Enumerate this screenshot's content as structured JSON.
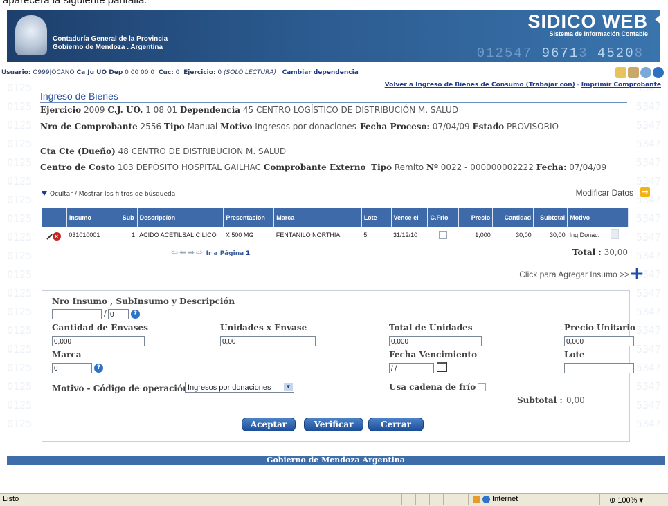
{
  "caption": "aparecerá la siguiente pantalla:",
  "banner": {
    "org_line1": "Contaduría General de la Provincia",
    "org_line2": "Gobierno de Mendoza . Argentina",
    "brand": "SIDICO  WEB",
    "brand_sub": "Sistema de Información Contable",
    "digits_a": "012547 ",
    "digits_b": "9671",
    "digits_c": "3 ",
    "digits_d": "4520",
    "digits_e": "8"
  },
  "userbar": {
    "label_usuario": "Usuario:",
    "usuario": "O999JOCANO",
    "label_caju": "Ca Ju UO Dep",
    "caju": "0 00 00 0",
    "label_cuc": "Cuc:",
    "cuc": "0",
    "label_ejercicio": "Ejercicio:",
    "ejercicio": "0",
    "mode": "(SOLO LECTURA)",
    "change_link": "Cambiar dependencia"
  },
  "links": {
    "back": "Volver a Ingreso de Bienes de Consumo (Trabajar con)",
    "sep": " - ",
    "print": "Imprimir Comprobante"
  },
  "title": "Ingreso de Bienes",
  "info": {
    "l_ejercicio": "Ejercicio",
    "ejercicio": "2009",
    "l_cju": "C.J. UO.",
    "cju": "1 08 01",
    "l_dependencia": "Dependencia",
    "dependencia": "45 CENTRO LOGÍSTICO DE DISTRIBUCIÓN M. SALUD",
    "l_nro": "Nro de Comprobante",
    "nro": "2556",
    "l_tipo": "Tipo",
    "tipo": "Manual",
    "l_motivo": "Motivo",
    "motivo": "Ingresos por donaciones",
    "l_fecha_proceso": "Fecha Proceso:",
    "fecha_proceso": "07/04/09",
    "l_estado": "Estado",
    "estado": "PROVISORIO",
    "l_ctacte": "Cta Cte (Dueño)",
    "ctacte": "48 CENTRO DE DISTRIBUCION M. SALUD",
    "l_centro": "Centro de Costo",
    "centro": "103 DEPÓSITO HOSPITAL GAILHAC",
    "l_comp_ext": "Comprobante Externo",
    "l_tipo2": "Tipo",
    "tipo2": "Remito",
    "l_numero": "Nº",
    "numero": "0022 - 000000002222",
    "l_fecha": "Fecha:",
    "fecha": "07/04/09"
  },
  "filters_toggle": "Ocultar / Mostrar los filtros de búsqueda",
  "modify_label": "Modificar Datos",
  "grid": {
    "headers": [
      "Insumo",
      "Sub",
      "Descripción",
      "Presentación",
      "Marca",
      "Lote",
      "Vence el",
      "C.Frio",
      "Precio",
      "Cantidad",
      "Subtotal",
      "Motivo"
    ],
    "row": {
      "insumo": "031010001",
      "sub": "1",
      "descripcion": "ACIDO ACETILSALICILICO",
      "presentacion": "X 500 MG",
      "marca": "FENTANILO NORTHIA",
      "lote": "5",
      "vence": "31/12/10",
      "precio": "1,000",
      "cantidad": "30,00",
      "subtotal": "30,00",
      "motivo": "Ing.Donac."
    }
  },
  "pager": {
    "label": "Ir a Página",
    "page": "1"
  },
  "total": {
    "label": "Total :",
    "value": "30,00"
  },
  "add_insumo": "Click para Agregar Insumo >>",
  "form": {
    "l_insumo": "Nro Insumo , SubInsumo y Descripción",
    "insumo_value": "",
    "slash": "/",
    "subinsumo_value": "0",
    "l_cant_env": "Cantidad de Envases",
    "cant_env": "0,000",
    "l_unid_env": "Unidades x Envase",
    "unid_env": "0,00",
    "l_total_unid": "Total de Unidades",
    "total_unid": "0,000",
    "l_precio_unit": "Precio Unitario",
    "precio_unit": "0,000",
    "l_marca": "Marca",
    "marca": "0",
    "l_fecha_venc": "Fecha Vencimiento",
    "fecha_venc": "/ /",
    "l_lote": "Lote",
    "lote": "",
    "l_motivo": "Motivo - Código de operación",
    "motivo": "Ingresos por donaciones",
    "l_cadena": "Usa cadena de frío",
    "l_subtotal": "Subtotal :",
    "subtotal": "0,00"
  },
  "buttons": {
    "aceptar": "Aceptar",
    "verificar": "Verificar",
    "cerrar": "Cerrar"
  },
  "footer": "Gobierno de Mendoza Argentina",
  "statusbar": {
    "status": "Listo",
    "zone": "Internet",
    "zoom": "100%"
  }
}
